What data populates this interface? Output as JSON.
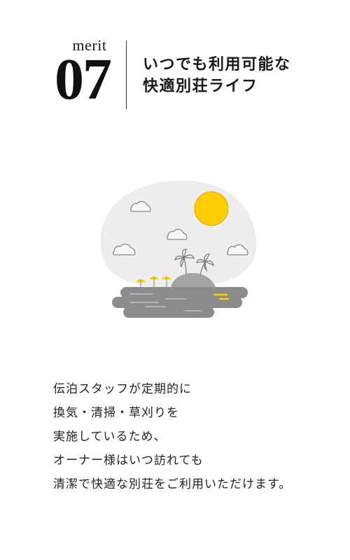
{
  "header": {
    "merit_label": "merit",
    "merit_number": "07",
    "title_lines": [
      "いつでも利用可能な",
      "快適別荘ライフ"
    ]
  },
  "illustration": {
    "icons": [
      "sun-icon",
      "cloud-icon",
      "palm-tree-icon",
      "beach-umbrella-icon",
      "island-icon"
    ],
    "colors": {
      "background_blob": "#ededed",
      "sun": "#ffcc00",
      "island": "#a3a3a3",
      "water": "#8c8c8c",
      "accent": "#ffcc00"
    }
  },
  "body": {
    "lines": [
      "伝泊スタッフが定期的に",
      "換気・清掃・草刈りを",
      "実施しているため、",
      "オーナー様はいつ訪れても",
      "清潔で快適な別荘をご利用いただけます。"
    ]
  }
}
